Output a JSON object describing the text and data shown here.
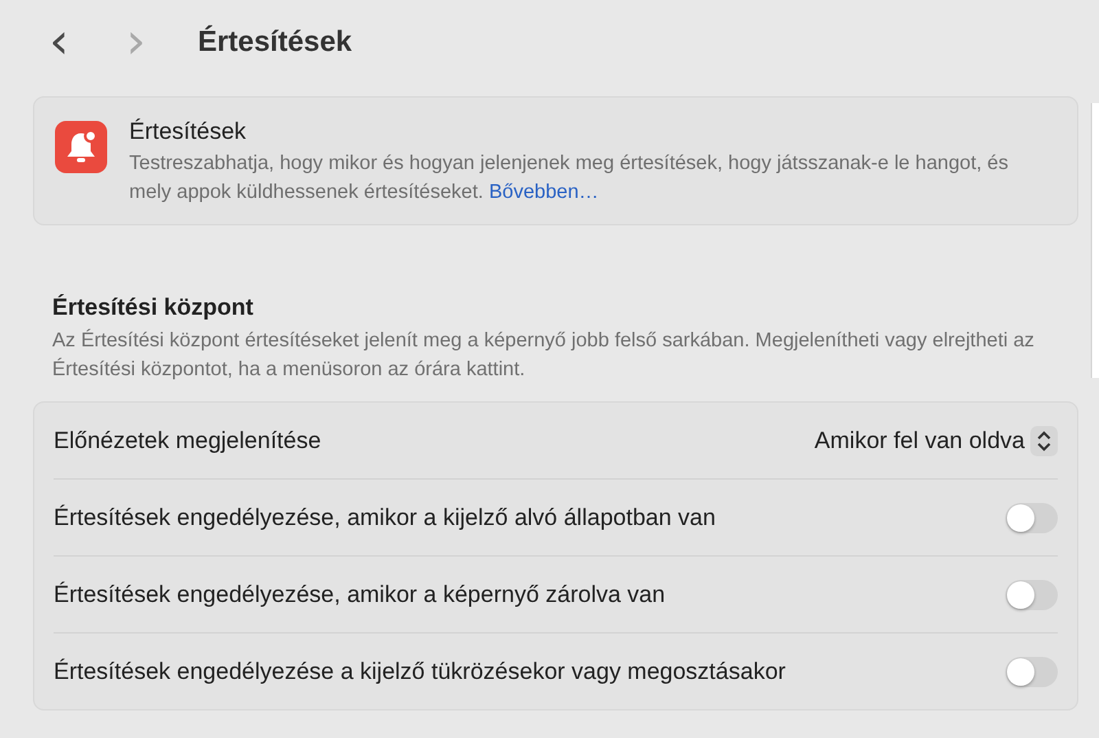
{
  "toolbar": {
    "back": "‹",
    "forward": "›",
    "title": "Értesítések"
  },
  "info_card": {
    "title": "Értesítések",
    "description": "Testreszabhatja, hogy mikor és hogyan jelenjenek meg értesítések, hogy játsszanak-e le hangot, és mely appok küldhessenek értesítéseket.",
    "link": "Bővebben…"
  },
  "section": {
    "title": "Értesítési központ",
    "description": "Az Értesítési központ értesítéseket jelenít meg a képernyő jobb felső sarkában. Megjelenítheti vagy elrejtheti az Értesítési központot, ha a menüsoron az órára kattint."
  },
  "settings": [
    {
      "kind": "popup",
      "label": "Előnézetek megjelenítése",
      "value": "Amikor fel van oldva"
    },
    {
      "kind": "toggle",
      "label": "Értesítések engedélyezése, amikor a kijelző alvó állapotban van",
      "on": false
    },
    {
      "kind": "toggle",
      "label": "Értesítések engedélyezése, amikor a képernyő zárolva van",
      "on": false
    },
    {
      "kind": "toggle",
      "label": "Értesítések engedélyezése a kijelző tükrözésekor vagy megosztásakor",
      "on": false
    }
  ]
}
